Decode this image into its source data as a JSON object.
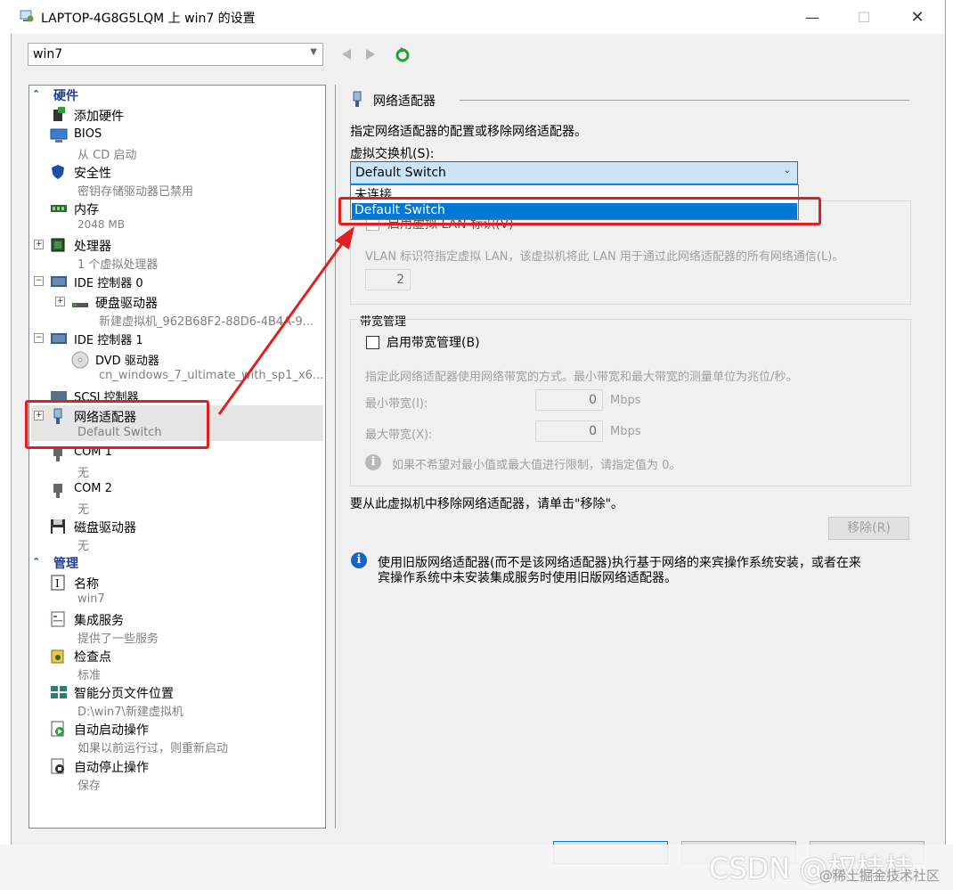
{
  "window": {
    "title": "LAPTOP-4G8G5LQM 上 win7 的设置"
  },
  "vm_select": {
    "value": "win7"
  },
  "tree": {
    "hardware_section": "硬件",
    "management_section": "管理",
    "hardware_items": [
      {
        "label": "添加硬件",
        "sub": ""
      },
      {
        "label": "BIOS",
        "sub": "从 CD 启动"
      },
      {
        "label": "安全性",
        "sub": "密钥存储驱动器已禁用"
      },
      {
        "label": "内存",
        "sub": "2048 MB"
      },
      {
        "label": "处理器",
        "sub": "1 个虚拟处理器"
      },
      {
        "label": "IDE 控制器 0",
        "sub": ""
      },
      {
        "label": "硬盘驱动器",
        "sub": "新建虚拟机_962B68F2-88D6-4B4A-9..."
      },
      {
        "label": "IDE 控制器 1",
        "sub": ""
      },
      {
        "label": "DVD 驱动器",
        "sub": "cn_windows_7_ultimate_with_sp1_x6..."
      },
      {
        "label": "SCSI 控制器",
        "sub": ""
      },
      {
        "label": "网络适配器",
        "sub": "Default Switch"
      },
      {
        "label": "COM 1",
        "sub": "无"
      },
      {
        "label": "COM 2",
        "sub": "无"
      },
      {
        "label": "磁盘驱动器",
        "sub": "无"
      }
    ],
    "management_items": [
      {
        "label": "名称",
        "sub": "win7"
      },
      {
        "label": "集成服务",
        "sub": "提供了一些服务"
      },
      {
        "label": "检查点",
        "sub": "标准"
      },
      {
        "label": "智能分页文件位置",
        "sub": "D:\\win7\\新建虚拟机"
      },
      {
        "label": "自动启动操作",
        "sub": "如果以前运行过，则重新启动"
      },
      {
        "label": "自动停止操作",
        "sub": "保存"
      }
    ]
  },
  "panel": {
    "heading": "网络适配器",
    "description": "指定网络适配器的配置或移除网络适配器。",
    "switch_label": "虚拟交换机(S):",
    "switch_value": "Default Switch",
    "dropdown_options": [
      "未连接",
      "Default Switch"
    ],
    "vlan_checkbox": "启用虚拟 LAN 标识(V)",
    "vlan_desc": "VLAN 标识符指定虚拟 LAN，该虚拟机将此 LAN 用于通过此网络适配器的所有网络通信(L)。",
    "vlan_value": "2",
    "bandwidth_title": "带宽管理",
    "bandwidth_checkbox": "启用带宽管理(B)",
    "bandwidth_desc": "指定此网络适配器使用网络带宽的方式。最小带宽和最大带宽的测量单位为兆位/秒。",
    "min_label": "最小带宽(I):",
    "min_value": "0",
    "max_label": "最大带宽(X):",
    "max_value": "0",
    "unit": "Mbps",
    "limit_note": "如果不希望对最小值或最大值进行限制，请指定值为 0。",
    "remove_text": "要从此虚拟机中移除网络适配器，请单击\"移除\"。",
    "remove_button": "移除(R)",
    "legacy_note_line1": "使用旧版网络适配器(而不是该网络适配器)执行基于网络的来宾操作系统安装，或者在来",
    "legacy_note_line2": "宾操作系统中未安装集成服务时使用旧版网络适配器。"
  },
  "watermark": {
    "main": "CSDN @权桂桂",
    "sub": "@稀土掘金技术社区"
  },
  "colors": {
    "accent": "#0078d7",
    "annotation": "#e02020",
    "section": "#1c3f94"
  }
}
